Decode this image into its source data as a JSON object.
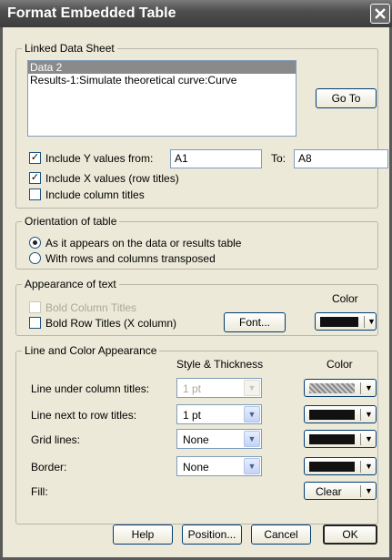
{
  "window": {
    "title": "Format Embedded Table"
  },
  "linked_data_sheet": {
    "label": "Linked Data Sheet",
    "items": [
      "Data 2",
      "Results-1:Simulate theoretical curve:Curve"
    ],
    "selected_index": 0,
    "goto_label": "Go To"
  },
  "include": {
    "y_label": "Include Y values from:",
    "y_checked": true,
    "from_value": "A1",
    "to_label": "To:",
    "to_value": "A8",
    "x_label": "Include X values (row titles)",
    "x_checked": true,
    "col_label": "Include column titles",
    "col_checked": false
  },
  "orientation": {
    "label": "Orientation of table",
    "options": [
      "As it appears on the data or results table",
      "With rows and columns transposed"
    ],
    "selected": 0
  },
  "appearance_text": {
    "label": "Appearance of text",
    "bold_col_label": "Bold Column Titles",
    "bold_row_label": "Bold Row Titles (X column)",
    "font_button": "Font...",
    "color_header": "Color"
  },
  "line_color": {
    "label": "Line and Color Appearance",
    "style_header": "Style & Thickness",
    "color_header": "Color",
    "rows": [
      {
        "label": "Line under column titles:",
        "value": "1 pt"
      },
      {
        "label": "Line next to row titles:",
        "value": "1 pt"
      },
      {
        "label": "Grid lines:",
        "value": "None"
      },
      {
        "label": "Border:",
        "value": "None"
      },
      {
        "label": "Fill:"
      }
    ],
    "fill_value": "Clear"
  },
  "buttons": {
    "help": "Help",
    "position": "Position...",
    "cancel": "Cancel",
    "ok": "OK"
  },
  "colors": {
    "swatch": "#111111"
  }
}
